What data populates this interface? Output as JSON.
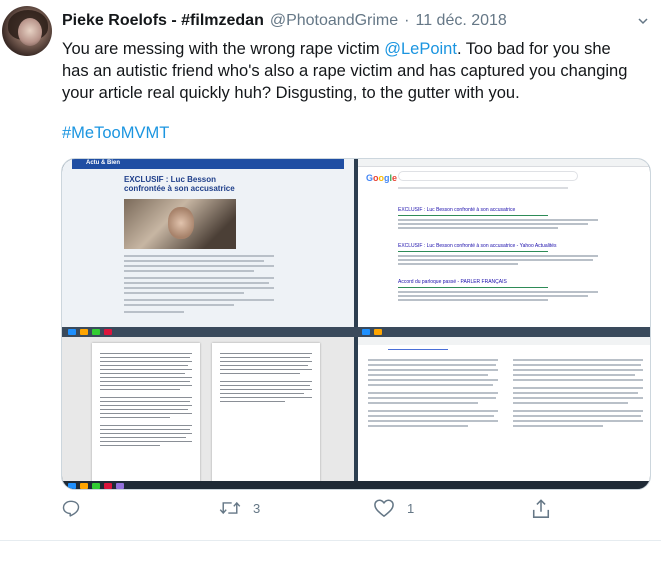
{
  "tweet": {
    "author_name": "Pieke Roelofs - #filmzedan",
    "author_handle": "@PhotoandGrime",
    "separator": "·",
    "date": "11 déc. 2018",
    "text_part1": "You are messing with the wrong rape victim ",
    "mention": "@LePoint",
    "text_part2": ". Too bad for you she has an autistic friend who's also a rape victim and has captured you changing your article real quickly huh? Disgusting, to the gutter with you.",
    "hashtag": "#MeTooMVMT"
  },
  "media": {
    "article_title": "EXCLUSIF : Luc Besson confrontée à son accusatrice",
    "article_logo": "Actu & Bien",
    "google_logo_letters": [
      "G",
      "o",
      "o",
      "g",
      "l",
      "e"
    ],
    "search_results": [
      "EXCLUSIF : Luc Besson confronté à son accusatrice",
      "EXCLUSIF : Luc Besson confronté à son accusatrice - Yahoo Actualités",
      "Accord du parloque passé - PARLER FRANÇAIS"
    ]
  },
  "actions": {
    "reply_count": "",
    "retweet_count": "3",
    "like_count": "1"
  },
  "colors": {
    "link": "#1b95e0",
    "secondary": "#657786",
    "text": "#14171a"
  },
  "icons": [
    "reply-icon",
    "retweet-icon",
    "like-icon",
    "share-icon",
    "chevron-down-icon"
  ]
}
